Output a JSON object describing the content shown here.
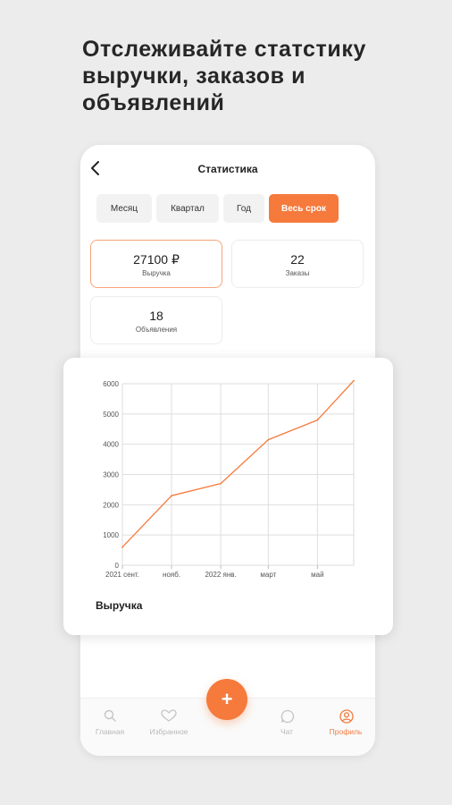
{
  "headline": "Отслеживайте статстику выручки, заказов и объявлений",
  "screen": {
    "title": "Статистика",
    "periods": [
      {
        "label": "Месяц",
        "active": false
      },
      {
        "label": "Квартал",
        "active": false
      },
      {
        "label": "Год",
        "active": false
      },
      {
        "label": "Весь срок",
        "active": true
      }
    ],
    "stats": [
      {
        "value": "27100 ₽",
        "label": "Выручка",
        "active": true
      },
      {
        "value": "22",
        "label": "Заказы",
        "active": false
      },
      {
        "value": "18",
        "label": "Объявления",
        "active": false
      }
    ]
  },
  "chart_card": {
    "caption": "Выручка"
  },
  "chart_data": {
    "type": "line",
    "x_ticks": [
      "2021 сент.",
      "нояб.",
      "2022 янв.",
      "март",
      "май"
    ],
    "x": [
      "2021-09-01",
      "2021-11-01",
      "2022-01-01",
      "2022-03-01",
      "2022-05-01",
      "2022-06-15"
    ],
    "values": [
      600,
      2300,
      2700,
      4150,
      4800,
      6100
    ],
    "y_ticks": [
      0,
      1000,
      2000,
      3000,
      4000,
      5000,
      6000
    ],
    "ylim": [
      0,
      6000
    ],
    "grid": true,
    "color": "#f57a3c"
  },
  "nav": {
    "items": [
      {
        "label": "Главная",
        "icon": "search-icon",
        "active": false
      },
      {
        "label": "Избранное",
        "icon": "heart-icon",
        "active": false
      },
      {
        "label": "",
        "icon": "",
        "active": false
      },
      {
        "label": "Чат",
        "icon": "chat-icon",
        "active": false
      },
      {
        "label": "Профиль",
        "icon": "profile-icon",
        "active": true
      }
    ],
    "fab_label": "+"
  },
  "colors": {
    "accent": "#f57a3c",
    "background": "#ececec"
  }
}
